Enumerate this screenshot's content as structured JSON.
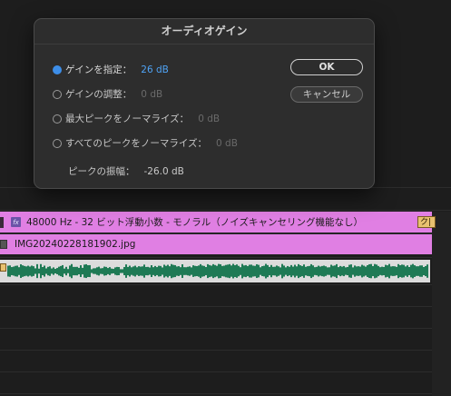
{
  "dialog": {
    "title": "オーディオゲイン",
    "options": [
      {
        "label": "ゲインを指定：",
        "value": "26 dB",
        "checked": true
      },
      {
        "label": "ゲインの調整：",
        "value": "0 dB",
        "checked": false
      },
      {
        "label": "最大ピークをノーマライズ：",
        "value": "0 dB",
        "checked": false
      },
      {
        "label": "すべてのピークをノーマライズ：",
        "value": "0 dB",
        "checked": false
      }
    ],
    "peak_label": "ピークの振幅：",
    "peak_value": "-26.0 dB",
    "ok_label": "OK",
    "cancel_label": "キャンセル"
  },
  "timeline": {
    "audio_clip_label": "48000 Hz - 32 ビット浮動小数 - モノラル（ノイズキャンセリング機能なし）",
    "fx_label": "fx",
    "audio_clip_tag": "ク|",
    "image_clip_label": "IMG20240228181902.jpg"
  },
  "colors": {
    "clip_pink": "#e07fe3",
    "waveform_green": "#1f7a55",
    "accent_blue": "#3d8ee8"
  }
}
